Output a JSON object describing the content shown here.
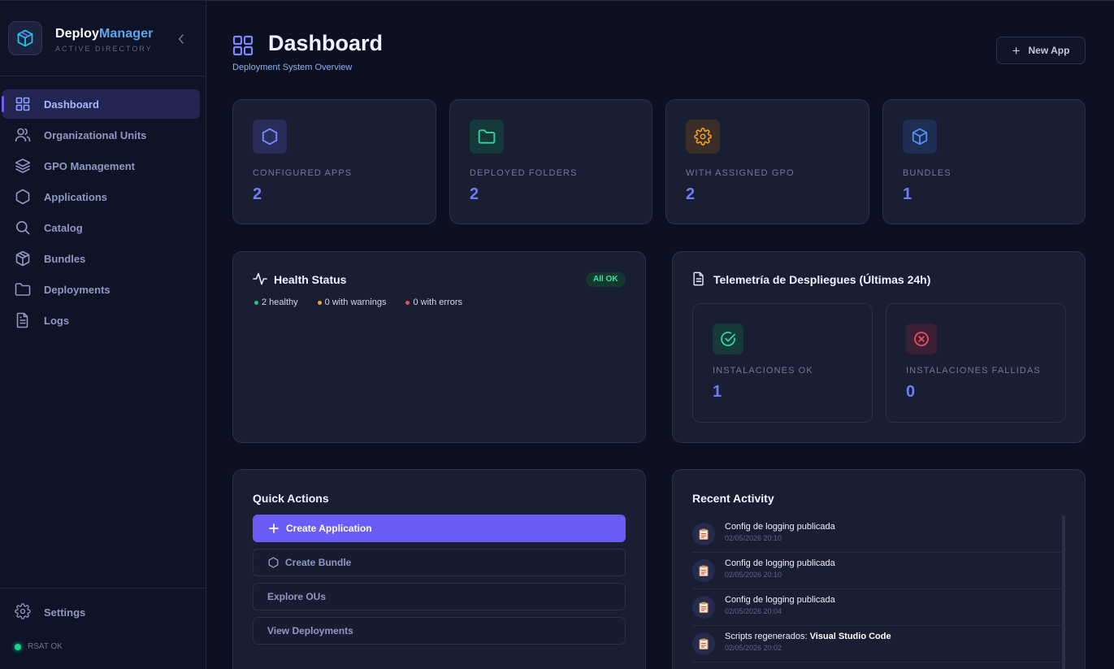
{
  "brand": {
    "name_part1": "Deploy",
    "name_part2": "Manager",
    "subtitle": "ACTIVE DIRECTORY"
  },
  "sidebar": {
    "items": [
      {
        "label": "Dashboard",
        "icon": "grid-icon",
        "active": true
      },
      {
        "label": "Organizational Units",
        "icon": "users-icon"
      },
      {
        "label": "GPO Management",
        "icon": "layers-icon"
      },
      {
        "label": "Applications",
        "icon": "hexagon-icon"
      },
      {
        "label": "Catalog",
        "icon": "search-icon"
      },
      {
        "label": "Bundles",
        "icon": "package-icon"
      },
      {
        "label": "Deployments",
        "icon": "folder-icon"
      },
      {
        "label": "Logs",
        "icon": "file-text-icon"
      }
    ],
    "settings_label": "Settings",
    "status_text": "RSAT OK"
  },
  "header": {
    "title": "Dashboard",
    "subtitle": "Deployment System Overview",
    "new_app_label": "New App"
  },
  "stats": [
    {
      "label": "CONFIGURED APPS",
      "value": "2",
      "icon": "hexagon-icon",
      "color": "#6f7cf6"
    },
    {
      "label": "DEPLOYED FOLDERS",
      "value": "2",
      "icon": "folder-icon",
      "color": "#2fd4a6"
    },
    {
      "label": "WITH ASSIGNED GPO",
      "value": "2",
      "icon": "gear-icon",
      "color": "#f2a22b"
    },
    {
      "label": "BUNDLES",
      "value": "1",
      "icon": "package-icon",
      "color": "#4c8ff0"
    }
  ],
  "health": {
    "title": "Health Status",
    "badge": "All OK",
    "healthy": "2 healthy",
    "warnings": "0 with warnings",
    "errors": "0 with errors"
  },
  "telemetry": {
    "title": "Telemetría de Despliegues (Últimas 24h)",
    "ok_label": "INSTALACIONES OK",
    "ok_value": "1",
    "fail_label": "INSTALACIONES FALLIDAS",
    "fail_value": "0"
  },
  "quick_actions": {
    "title": "Quick Actions",
    "create_app": "Create Application",
    "create_bundle": "Create Bundle",
    "explore_ous": "Explore OUs",
    "view_deployments": "View Deployments"
  },
  "recent_activity": {
    "title": "Recent Activity",
    "items": [
      {
        "text": "Config de logging publicada",
        "bold": "",
        "time": "02/05/2026 20:10"
      },
      {
        "text": "Config de logging publicada",
        "bold": "",
        "time": "02/05/2026 20:10"
      },
      {
        "text": "Config de logging publicada",
        "bold": "",
        "time": "02/05/2026 20:04"
      },
      {
        "text": "Scripts regenerados: ",
        "bold": "Visual Studio Code",
        "time": "02/05/2026 20:02"
      }
    ]
  }
}
